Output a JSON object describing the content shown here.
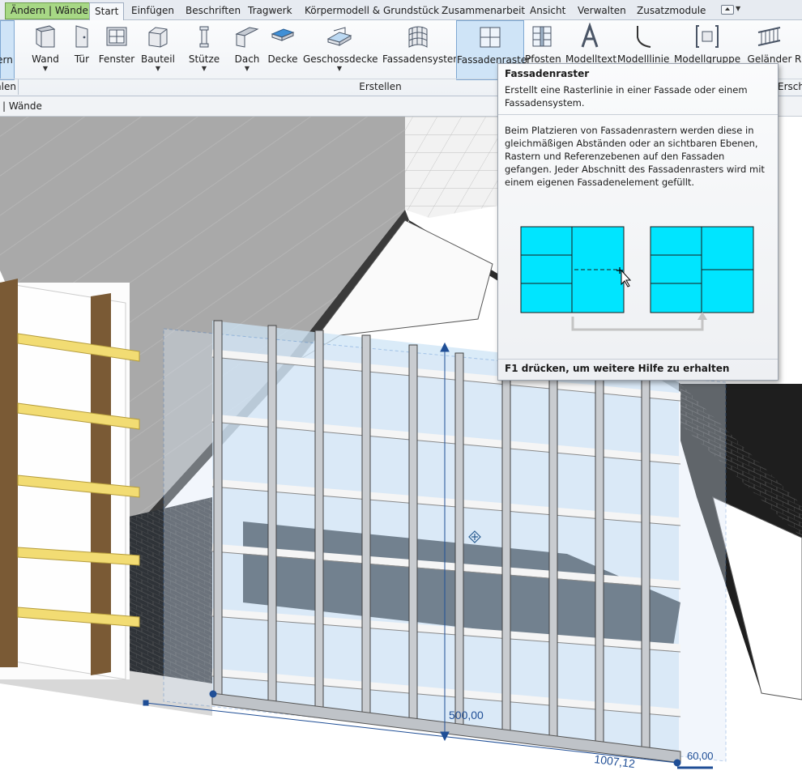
{
  "tabs": {
    "context": "Ändern | Wände",
    "items": [
      "Start",
      "Einfügen",
      "Beschriften",
      "Tragwerk",
      "Körpermodell & Grundstück",
      "Zusammenarbeit",
      "Ansicht",
      "Verwalten",
      "Zusatzmodule"
    ],
    "active": "Start"
  },
  "ribbon": {
    "left_partial_label": "ern",
    "buttons": {
      "wand": "Wand",
      "tuer": "Tür",
      "fenster": "Fenster",
      "bauteil": "Bauteil",
      "stuetze": "Stütze",
      "dach": "Dach",
      "decke": "Decke",
      "geschossdecke": "Geschossdecke",
      "fassadensystem": "Fassadensystem",
      "fassadenraster": "Fassadenraster",
      "pfosten": "Pfosten",
      "modelltext": "Modelltext",
      "modelllinie": "Modelllinie",
      "modellgruppe": "Modellgruppe",
      "gelaender": "Geländer",
      "rampe": "R"
    },
    "panel_left_label": "hlen",
    "panel_label": "Erstellen",
    "panel_right_label": "Erschl"
  },
  "context_bar": {
    "text": "| Wände"
  },
  "tooltip": {
    "title": "Fassadenraster",
    "short_description": "Erstellt eine Rasterlinie in einer Fassade oder einem Fassadensystem.",
    "long_description": "Beim Platzieren von Fassadenrastern werden diese in gleichmäßigen Abständen oder an sichtbaren Ebenen, Rastern und Referenzebenen auf den Fassaden gefangen. Jeder Abschnitt des Fassadenrasters wird mit einem eigenen Fassadenelement gefüllt.",
    "footer": "F1 drücken, um weitere Hilfe zu erhalten",
    "panel_color": "#00e5ff"
  },
  "viewport": {
    "dimensions": {
      "height": "500,00",
      "length": "1007,12",
      "side": "60,00"
    }
  },
  "colors": {
    "context_tab": "#a7d885",
    "selection": "#3b78c7",
    "roof": "#a9a9a9",
    "timber": "#7a5a35"
  }
}
